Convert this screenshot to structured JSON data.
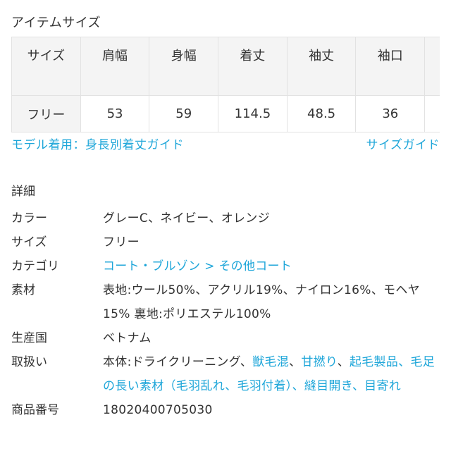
{
  "item_size": {
    "title": "アイテムサイズ",
    "table": {
      "headers": [
        "サイズ",
        "肩幅",
        "身幅",
        "着丈",
        "袖丈",
        "袖口",
        ""
      ],
      "rows": [
        [
          "フリー",
          "53",
          "59",
          "114.5",
          "48.5",
          "36",
          ""
        ]
      ]
    },
    "model_guide_link": "モデル着用：身長別着丈ガイド",
    "size_guide_link": "サイズガイド"
  },
  "details": {
    "title": "詳細",
    "color_label": "カラー",
    "color_value": "グレーC、ネイビー、オレンジ",
    "size_label": "サイズ",
    "size_value": "フリー",
    "category_label": "カテゴリ",
    "category_value": "コート・ブルゾン > その他コート",
    "material_label": "素材",
    "material_value": "表地:ウール50%、アクリル19%、ナイロン16%、モヘヤ15% 裏地:ポリエステル100%",
    "origin_label": "生産国",
    "origin_value": "ベトナム",
    "care_label": "取扱い",
    "care_prefix": "本体:ドライクリーニング、",
    "care_links": [
      "獣毛混",
      "甘撚り",
      "起毛製品",
      "毛足の長い素材（毛羽乱れ、毛羽付着）",
      "縫目開き",
      "目寄れ"
    ],
    "care_separator": "、",
    "product_number_label": "商品番号",
    "product_number_value": "18020400705030"
  },
  "colors": {
    "text": "#333333",
    "link": "#1ea6d9",
    "table_header_bg": "#f4f4f4",
    "table_border": "#e2e2e2"
  }
}
